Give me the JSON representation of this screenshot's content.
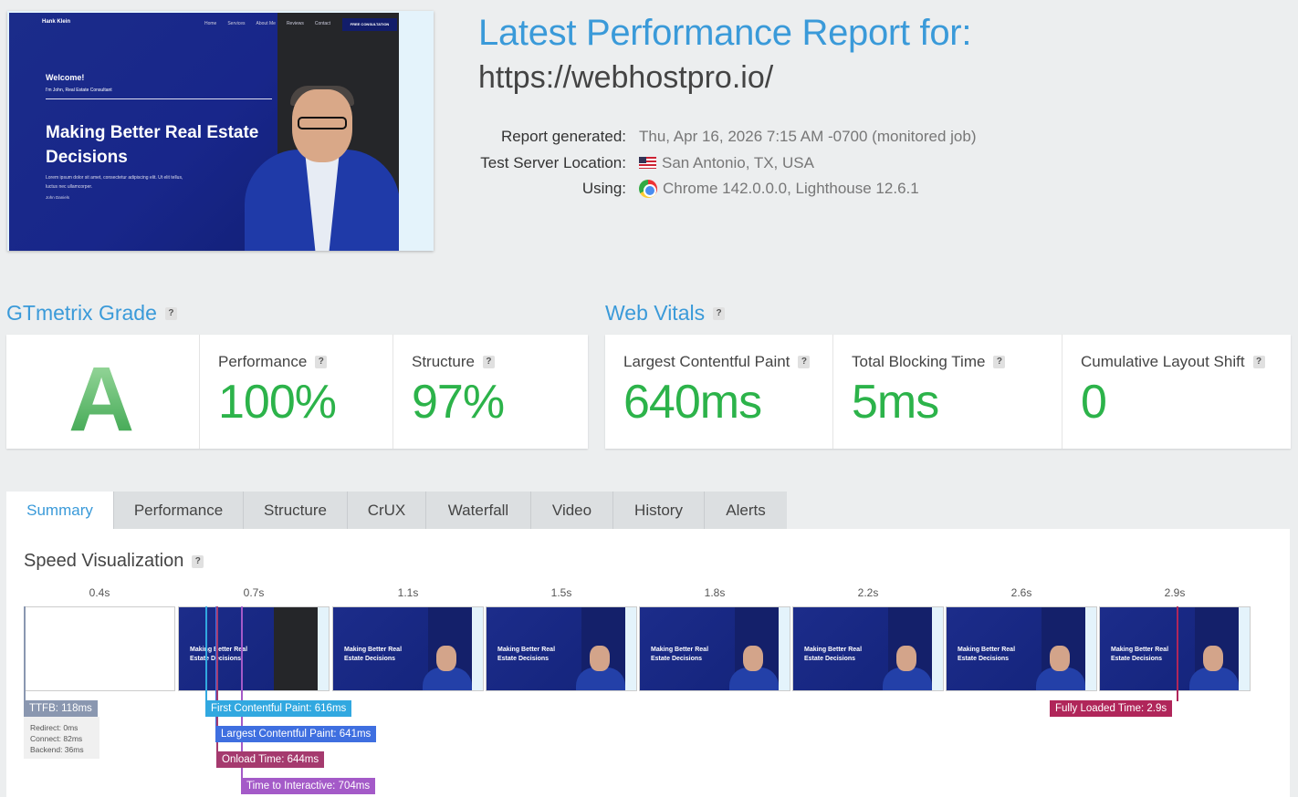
{
  "preview": {
    "logo": "Hank Klein",
    "nav": [
      "Home",
      "Services",
      "About Me",
      "Reviews",
      "Contact"
    ],
    "cta": "FREE CONSULTATION",
    "welcome": "Welcome!",
    "intro": "I'm John, Real Estate Consultant",
    "headline": "Making Better Real Estate Decisions",
    "lorem": "Lorem ipsum dolor sit amet, consectetur adipiscing elit. Ut elit tellus, luctus nec ullamcorper.",
    "signature": "John Daniels"
  },
  "header": {
    "title": "Latest Performance Report for:",
    "url": "https://webhostpro.io/"
  },
  "meta": {
    "generated_label": "Report generated:",
    "generated_value": "Thu, Apr 16, 2026 7:15 AM -0700 (monitored job)",
    "location_label": "Test Server Location:",
    "location_value": "San Antonio, TX, USA",
    "using_label": "Using:",
    "using_value": "Chrome 142.0.0.0, Lighthouse 12.6.1"
  },
  "grade": {
    "heading": "GTmetrix Grade",
    "help": "?",
    "letter": "A",
    "performance_label": "Performance",
    "performance_value": "100%",
    "structure_label": "Structure",
    "structure_value": "97%"
  },
  "vitals": {
    "heading": "Web Vitals",
    "help": "?",
    "lcp_label": "Largest Contentful Paint",
    "lcp_value": "640ms",
    "tbt_label": "Total Blocking Time",
    "tbt_value": "5ms",
    "cls_label": "Cumulative Layout Shift",
    "cls_value": "0"
  },
  "tabs": [
    "Summary",
    "Performance",
    "Structure",
    "CrUX",
    "Waterfall",
    "Video",
    "History",
    "Alerts"
  ],
  "active_tab": "Summary",
  "speed": {
    "title": "Speed Visualization",
    "help": "?",
    "frame_times": [
      "0.4s",
      "0.7s",
      "1.1s",
      "1.5s",
      "1.8s",
      "2.2s",
      "2.6s",
      "2.9s"
    ],
    "frame_headline": "Making Better Real Estate Decisions",
    "markers": {
      "ttfb": "TTFB: 118ms",
      "fcp": "First Contentful Paint: 616ms",
      "lcp": "Largest Contentful Paint: 641ms",
      "onload": "Onload Time: 644ms",
      "tti": "Time to Interactive: 704ms",
      "fully_loaded": "Fully Loaded Time: 2.9s"
    },
    "ttfb_breakdown": {
      "redirect": "Redirect: 0ms",
      "connect": "Connect: 82ms",
      "backend": "Backend: 36ms"
    }
  },
  "colors": {
    "accent_blue": "#3a9ad9",
    "grade_green": "#2cb34a",
    "ttfb": "#8a97b0",
    "fcp": "#31a8e0",
    "lcp": "#3f6fe0",
    "onload": "#a53a6e",
    "tti": "#a45ac8",
    "fully_loaded": "#b0265a"
  }
}
